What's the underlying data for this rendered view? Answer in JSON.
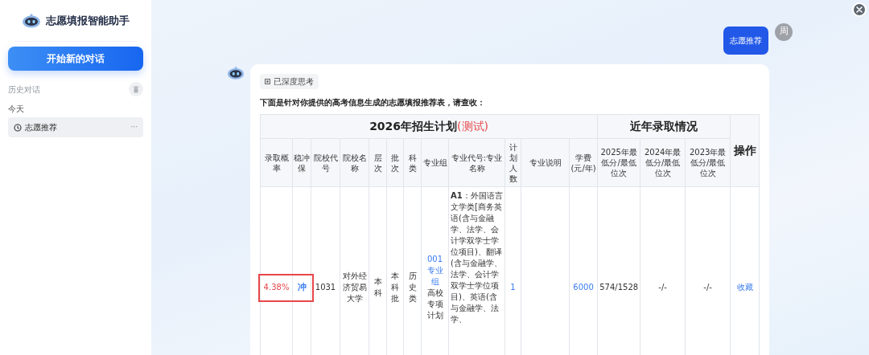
{
  "sidebar": {
    "app_title": "志愿填报智能助手",
    "new_chat_button": "开始新的对话",
    "history_label": "历史对话",
    "groups": [
      {
        "label": "今天",
        "items": [
          {
            "title": "志愿推荐",
            "more": "···",
            "selected": true
          }
        ]
      }
    ]
  },
  "chat": {
    "user_message": {
      "text": "志愿推荐",
      "avatar": "周"
    },
    "assistant_message": {
      "thinking_badge": "已深度思考",
      "intro": "下面是针对你提供的高考信息生成的志愿填报推荐表，请查收：",
      "table": {
        "group_headers": [
          {
            "text": "2026年招生计划",
            "note": "(测试)",
            "columns": [
              "录取概率",
              "稳冲保",
              "院校代号",
              "院校名称",
              "层次",
              "批次",
              "科类",
              "专业组",
              "专业代号:专业名称",
              "计划人数",
              "专业说明",
              "学费(元/年)"
            ]
          },
          {
            "text": "近年录取情况",
            "columns": [
              "2025年最低分/最低位次",
              "2024年最低分/最低位次",
              "2023年最低分/最低位次"
            ]
          }
        ],
        "action_header": "操作",
        "rows": [
          {
            "cells": [
              {
                "parts": [
                  {
                    "text": "4.38%",
                    "color": "#e6484b"
                  }
                ],
                "boxed": true
              },
              {
                "parts": [
                  {
                    "text": "冲",
                    "color": "#3a7bf0"
                  }
                ],
                "boxed": true
              },
              {
                "parts": [
                  {
                    "text": "1031"
                  }
                ],
                "boxed": false
              },
              {
                "parts": [
                  {
                    "text": "对外经济贸易大学"
                  }
                ],
                "boxed": false
              },
              {
                "parts": [
                  {
                    "text": "本科"
                  }
                ],
                "boxed": false
              },
              {
                "parts": [
                  {
                    "text": "本科批"
                  }
                ],
                "boxed": false
              },
              {
                "parts": [
                  {
                    "text": "历史类"
                  }
                ],
                "boxed": false
              },
              {
                "parts": [
                  {
                    "text": "001专业组",
                    "color": "#3a7bf0"
                  },
                  {
                    "text": "高校专项计划"
                  }
                ],
                "boxed": false
              },
              {
                "parts": [
                  {
                    "text": "**A1**：外国语言文学类[商务英语(含与金融学、法学、会计学双学士学位项目)、翻译(含与金融学、法学、会计学双学士学位项目)、英语(含与金融学、法学、"
                  }
                ],
                "boxed": false
              },
              {
                "parts": [
                  {
                    "text": "1",
                    "color": "#3a7bf0"
                  }
                ],
                "boxed": false
              },
              {
                "boxed": false
              },
              {
                "parts": [
                  {
                    "text": "6000",
                    "color": "#3a7bf0"
                  }
                ],
                "boxed": false
              },
              {
                "parts": [
                  {
                    "text": "574/1528"
                  }
                ],
                "boxed": false
              },
              {
                "parts": [
                  {
                    "text": "-/-"
                  }
                ],
                "boxed": false
              },
              {
                "parts": [
                  {
                    "text": "-/-"
                  }
                ],
                "boxed": false
              }
            ],
            "action": "收藏"
          }
        ]
      }
    }
  }
}
